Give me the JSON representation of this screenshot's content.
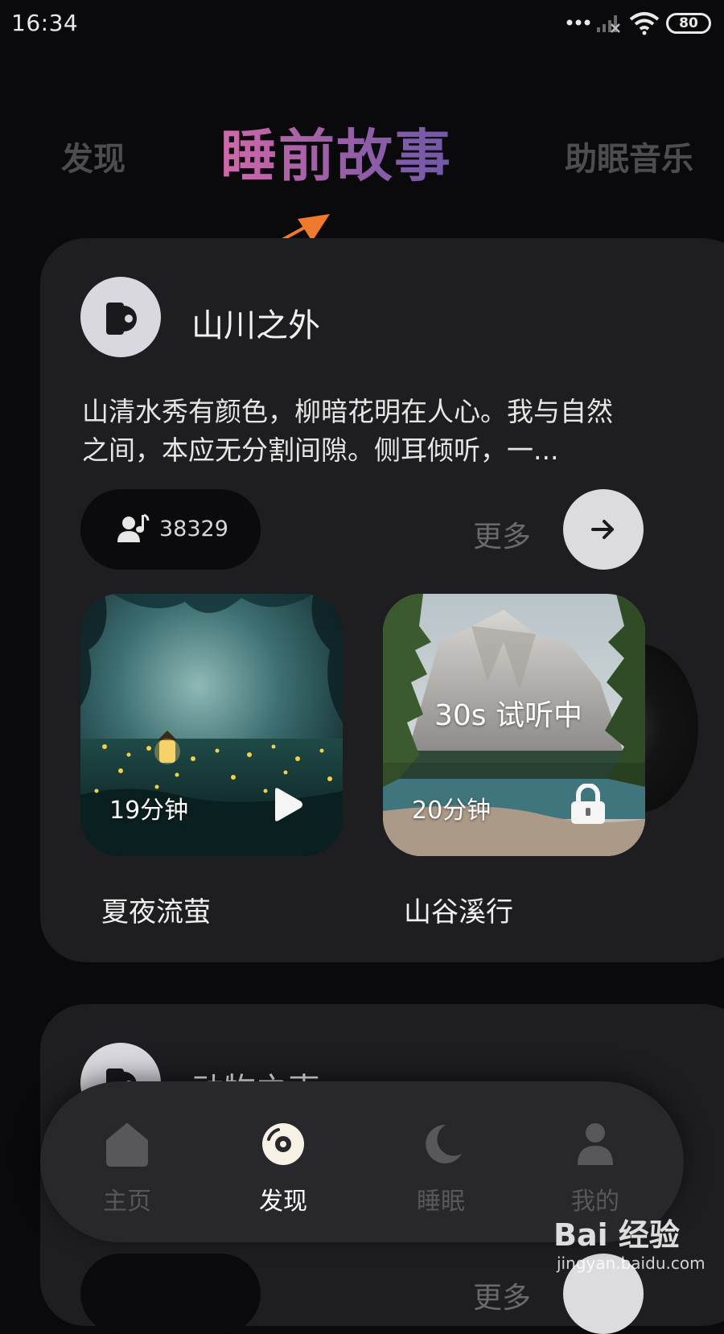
{
  "status_bar": {
    "time": "16:34",
    "battery": "80"
  },
  "top_tabs": [
    "发现",
    "睡前故事",
    "助眠音乐"
  ],
  "category1": {
    "title": "山川之外",
    "description": "山清水秀有颜色，柳暗花明在人心。我与自然之间，本应无分割间隙。侧耳倾听，一...",
    "listen_count": "38329",
    "more_label": "更多",
    "stories": [
      {
        "title": "夏夜流萤",
        "duration": "19分钟",
        "icon": "play-icon"
      },
      {
        "title": "山谷溪行",
        "duration": "20分钟",
        "overlay": "30s 试听中",
        "icon": "lock-icon"
      }
    ]
  },
  "category2": {
    "title": "动物之声",
    "more_label": "更多"
  },
  "bottom_nav": [
    {
      "label": "主页",
      "icon": "home-icon",
      "active": false
    },
    {
      "label": "发现",
      "icon": "discover-icon",
      "active": true
    },
    {
      "label": "睡眠",
      "icon": "moon-icon",
      "active": false
    },
    {
      "label": "我的",
      "icon": "profile-icon",
      "active": false
    }
  ],
  "watermark": {
    "brand": "Bai 经验",
    "url": "jingyan.baidu.com"
  },
  "colors": {
    "background": "#0a090b",
    "card": "#1e1d20",
    "accent_start": "#d06aa8",
    "accent_end": "#6f5aa8",
    "annotation_arrow": "#f07a2c"
  }
}
